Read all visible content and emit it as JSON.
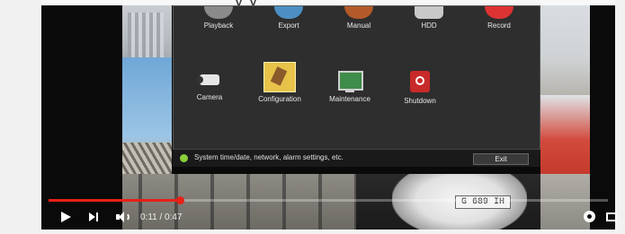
{
  "page_title_partial": "y         y",
  "menu": {
    "row1": [
      {
        "label": "Playback",
        "icon": "playback-icon"
      },
      {
        "label": "Export",
        "icon": "export-icon"
      },
      {
        "label": "Manual",
        "icon": "manual-icon"
      },
      {
        "label": "HDD",
        "icon": "hdd-icon"
      },
      {
        "label": "Record",
        "icon": "record-icon"
      }
    ],
    "row2": [
      {
        "label": "Camera",
        "icon": "camera-icon"
      },
      {
        "label": "Configuration",
        "icon": "configuration-icon",
        "selected": true
      },
      {
        "label": "Maintenance",
        "icon": "maintenance-icon"
      },
      {
        "label": "Shutdown",
        "icon": "shutdown-icon"
      }
    ]
  },
  "status": {
    "text": "System time/date, network, alarm settings, etc.",
    "exit_label": "Exit",
    "indicator_color": "#8bcf3c"
  },
  "video": {
    "plate_text": "G 689 IH"
  },
  "player": {
    "current_time": "0:11",
    "duration": "0:47",
    "time_display": "0:11 / 0:47",
    "progress_fraction": 0.234,
    "accent_color": "#e62117"
  }
}
